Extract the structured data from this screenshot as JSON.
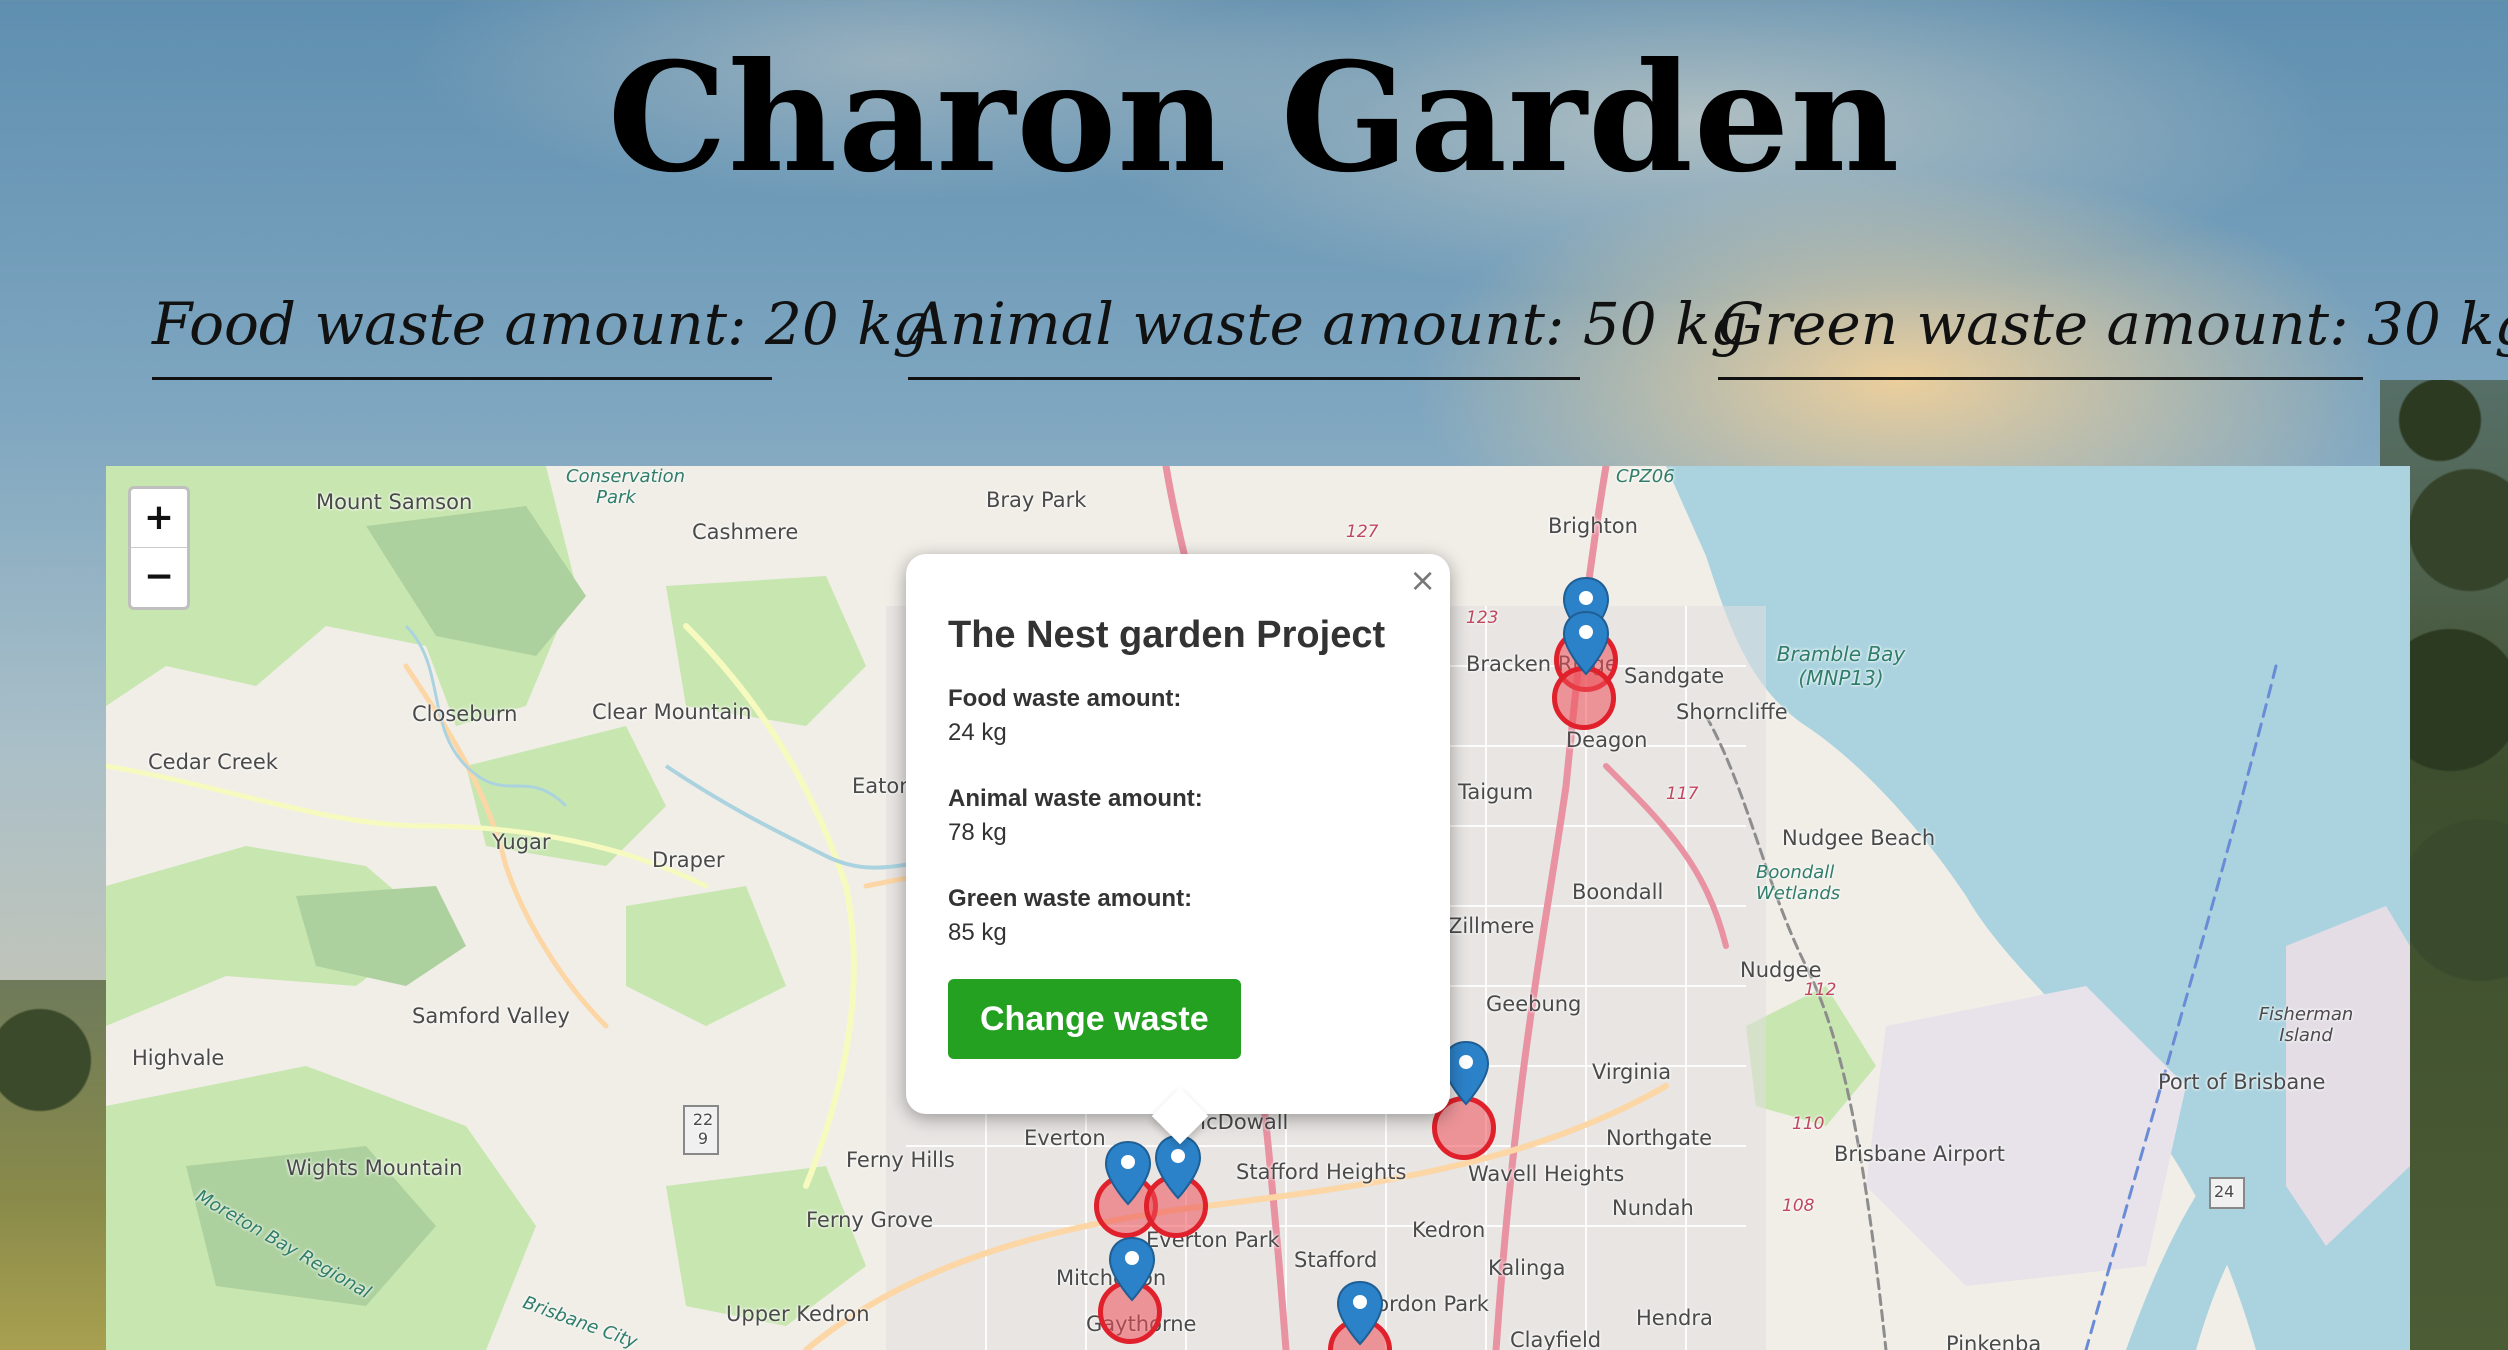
{
  "app": {
    "title": "Charon Garden"
  },
  "stats": {
    "food": "Food waste amount: 20 kg",
    "animal": "Animal waste amount: 50 kg",
    "green": "Green waste amount: 30 kg"
  },
  "map": {
    "zoom_in": "+",
    "zoom_out": "−",
    "labels": [
      "Mount Samson",
      "Cashmere",
      "Bray Park",
      "Brighton",
      "Closeburn",
      "Clear Mountain",
      "Cedar Creek",
      "Eaton",
      "Yugar",
      "Draper",
      "Samford Valley",
      "Highvale",
      "Wights Mountain",
      "Ferny Hills",
      "Ferny Grove",
      "Everton",
      "McDowall",
      "Stafford Heights",
      "Upper Kedron",
      "Mitchelton",
      "Gaythorne",
      "Everton Park",
      "Stafford",
      "Gordon Park",
      "Kedron",
      "Clayfield",
      "Kalinga",
      "Hendra",
      "Wavell Heights",
      "Nundah",
      "Northgate",
      "Virginia",
      "Geebung",
      "Zillmere",
      "Boondall",
      "Nudgee",
      "Nudgee Beach",
      "Deagon",
      "Sandgate",
      "Shorncliffe",
      "Bracken Ridge",
      "Taigum",
      "Bramble Bay (MNP13)",
      "Boondall Wetlands",
      "Brisbane Airport",
      "Port of Brisbane",
      "Fisherman Island",
      "Pinkenba",
      "Brisbane City",
      "Moreton Bay Regional",
      "Conservation Park",
      "CPZ06",
      "22 9",
      "24",
      "127",
      "123",
      "117",
      "112",
      "110",
      "108"
    ]
  },
  "popup": {
    "title": "The Nest garden Project",
    "close": "×",
    "food_label": "Food waste amount:",
    "food_value": "24 kg",
    "animal_label": "Animal waste amount:",
    "animal_value": "78 kg",
    "green_label": "Green waste amount:",
    "green_value": "85 kg",
    "button": "Change waste"
  },
  "colors": {
    "accent_button": "#24a121",
    "marker_blue": "#2c82c9",
    "circle_red": "#e0202a",
    "water": "#aad3df",
    "park": "#c8e6b0"
  }
}
